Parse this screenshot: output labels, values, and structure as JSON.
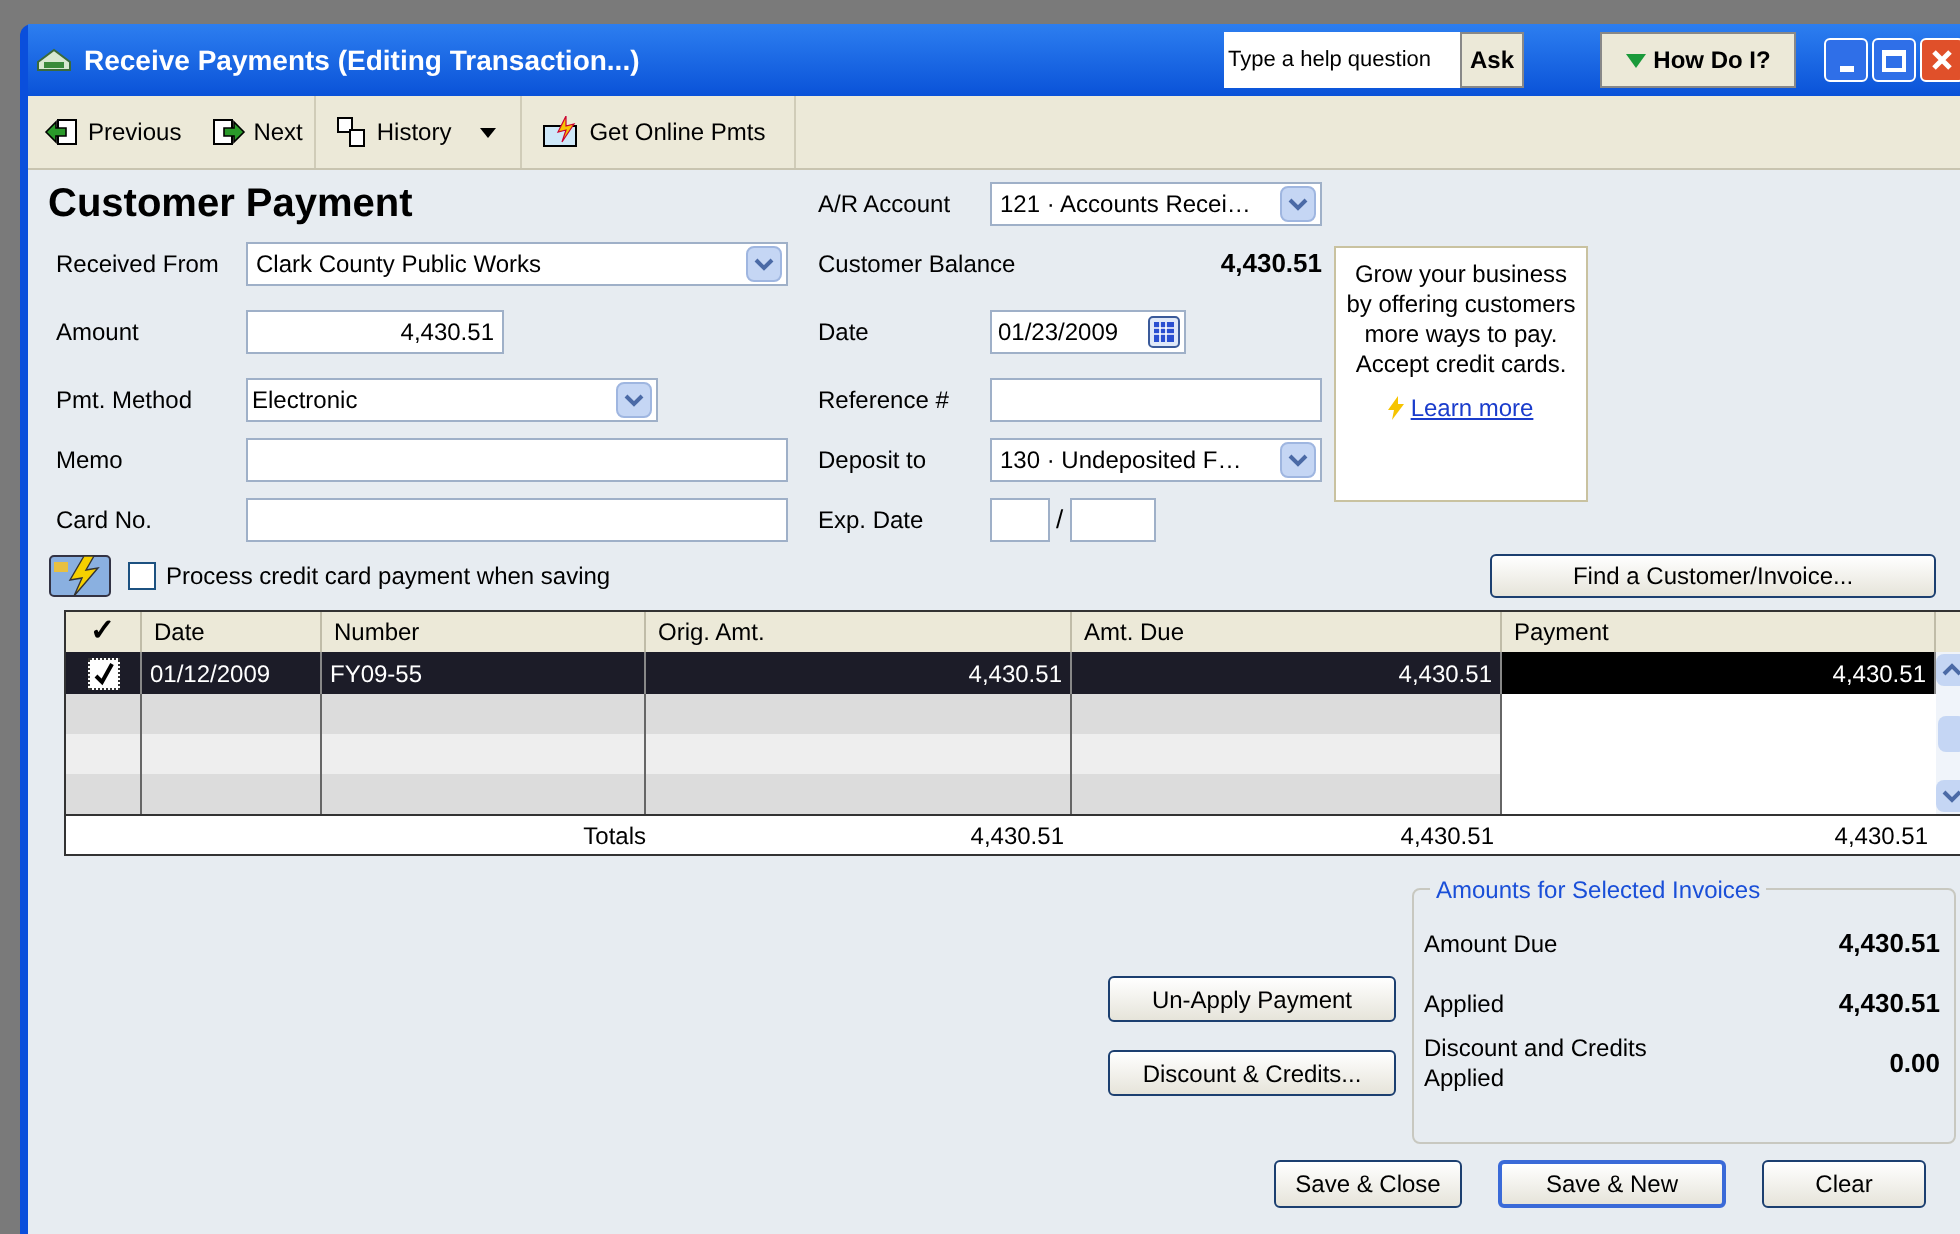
{
  "window": {
    "title": "Receive Payments (Editing Transaction...)"
  },
  "help": {
    "placeholder": "Type a help question",
    "ask": "Ask",
    "how_do_i": "How Do I?"
  },
  "toolbar": [
    {
      "label": "Previous",
      "kind": "previous"
    },
    {
      "label": "Next",
      "kind": "next"
    },
    {
      "label": "History",
      "kind": "history"
    },
    {
      "label": "Get Online Pmts",
      "kind": "online"
    }
  ],
  "form": {
    "heading": "Customer Payment",
    "left_fields": [
      {
        "label": "Received From",
        "value": "Clark County Public Works",
        "kind": "combo"
      },
      {
        "label": "Amount",
        "value": "4,430.51",
        "kind": "amount"
      },
      {
        "label": "Pmt. Method",
        "value": "Electronic",
        "kind": "combo_short"
      },
      {
        "label": "Memo",
        "kind": "text"
      },
      {
        "label": "Card No.",
        "kind": "text"
      }
    ],
    "right_fields": [
      {
        "label": "A/R Account",
        "value": "121 · Accounts Recei…",
        "kind": "combo"
      },
      {
        "label": "Customer Balance",
        "value": "4,430.51",
        "kind": "readout"
      },
      {
        "label": "Date",
        "value": "01/23/2009",
        "kind": "date"
      },
      {
        "label": "Reference #",
        "kind": "text"
      },
      {
        "label": "Deposit to",
        "value": "130 · Undeposited F…",
        "kind": "combo"
      },
      {
        "label": "Exp. Date",
        "kind": "exp",
        "separator": "/"
      }
    ],
    "process_card": {
      "label": "Process credit card payment when saving",
      "checked": false
    },
    "promo": {
      "text": "Grow your business by offering customers more ways to pay. Accept credit cards.",
      "link": "Learn more"
    },
    "find_button": "Find a Customer/Invoice..."
  },
  "table": {
    "check_header": "✓",
    "columns": [
      "Date",
      "Number",
      "Orig. Amt.",
      "Amt. Due",
      "Payment"
    ],
    "rows": [
      {
        "checked": true,
        "selected": true,
        "cells": [
          "01/12/2009",
          "FY09-55",
          "4,430.51",
          "4,430.51",
          "4,430.51"
        ]
      }
    ],
    "totals": {
      "label": "Totals",
      "values": [
        "4,430.51",
        "4,430.51",
        "4,430.51"
      ]
    }
  },
  "summary": {
    "title": "Amounts for Selected Invoices",
    "rows": [
      {
        "label": "Amount Due",
        "value": "4,430.51"
      },
      {
        "label": "Applied",
        "value": "4,430.51"
      },
      {
        "label": "Discount and Credits Applied",
        "value": "0.00"
      }
    ]
  },
  "side_buttons": [
    "Un-Apply Payment",
    "Discount & Credits..."
  ],
  "footer_buttons": [
    {
      "label": "Save & Close",
      "default": false
    },
    {
      "label": "Save & New",
      "default": true
    },
    {
      "label": "Clear",
      "default": false
    }
  ]
}
